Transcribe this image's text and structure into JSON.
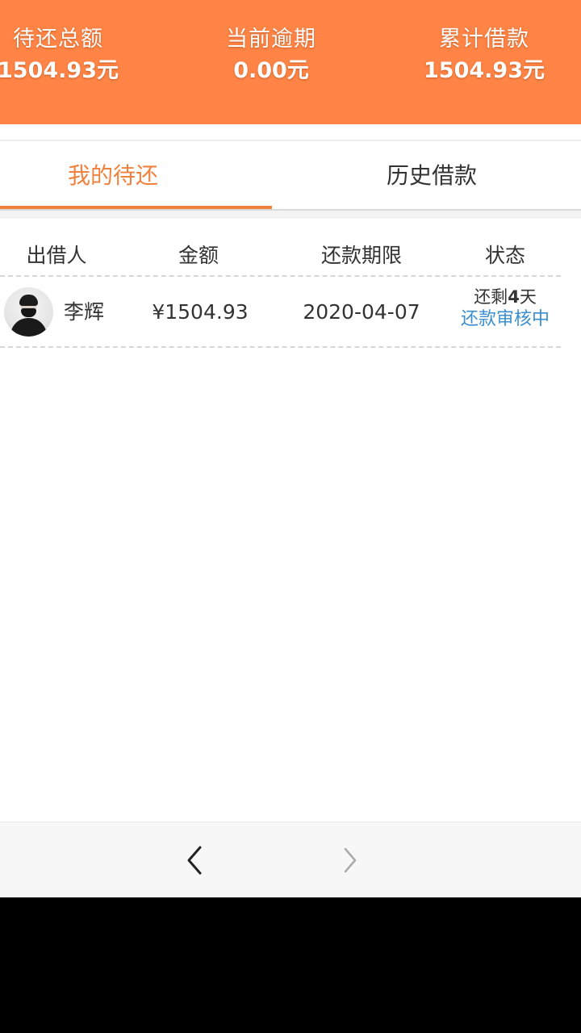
{
  "summary": {
    "pending_total_label": "待还总额",
    "pending_total_value": "1504.93元",
    "overdue_label": "当前逾期",
    "overdue_value": "0.00元",
    "cumulative_label": "累计借款",
    "cumulative_value": "1504.93元"
  },
  "tabs": {
    "mine_label": "我的待还",
    "history_label": "历史借款",
    "active": "mine"
  },
  "table": {
    "headers": [
      "出借人",
      "金额",
      "还款期限",
      "状态"
    ],
    "rows": [
      {
        "lender": "李辉",
        "amount": "¥1504.93",
        "deadline": "2020-04-07",
        "remain_prefix": "还剩",
        "remain_days": "4",
        "remain_suffix": "天",
        "review_status": "还款审核中"
      }
    ]
  },
  "nav": {
    "back_icon": "chevron-left-icon",
    "forward_icon": "chevron-right-icon",
    "forward_enabled": false
  },
  "colors": {
    "header_bg": "#ff8445",
    "accent": "#f0823f",
    "link": "#3b8fd0"
  }
}
